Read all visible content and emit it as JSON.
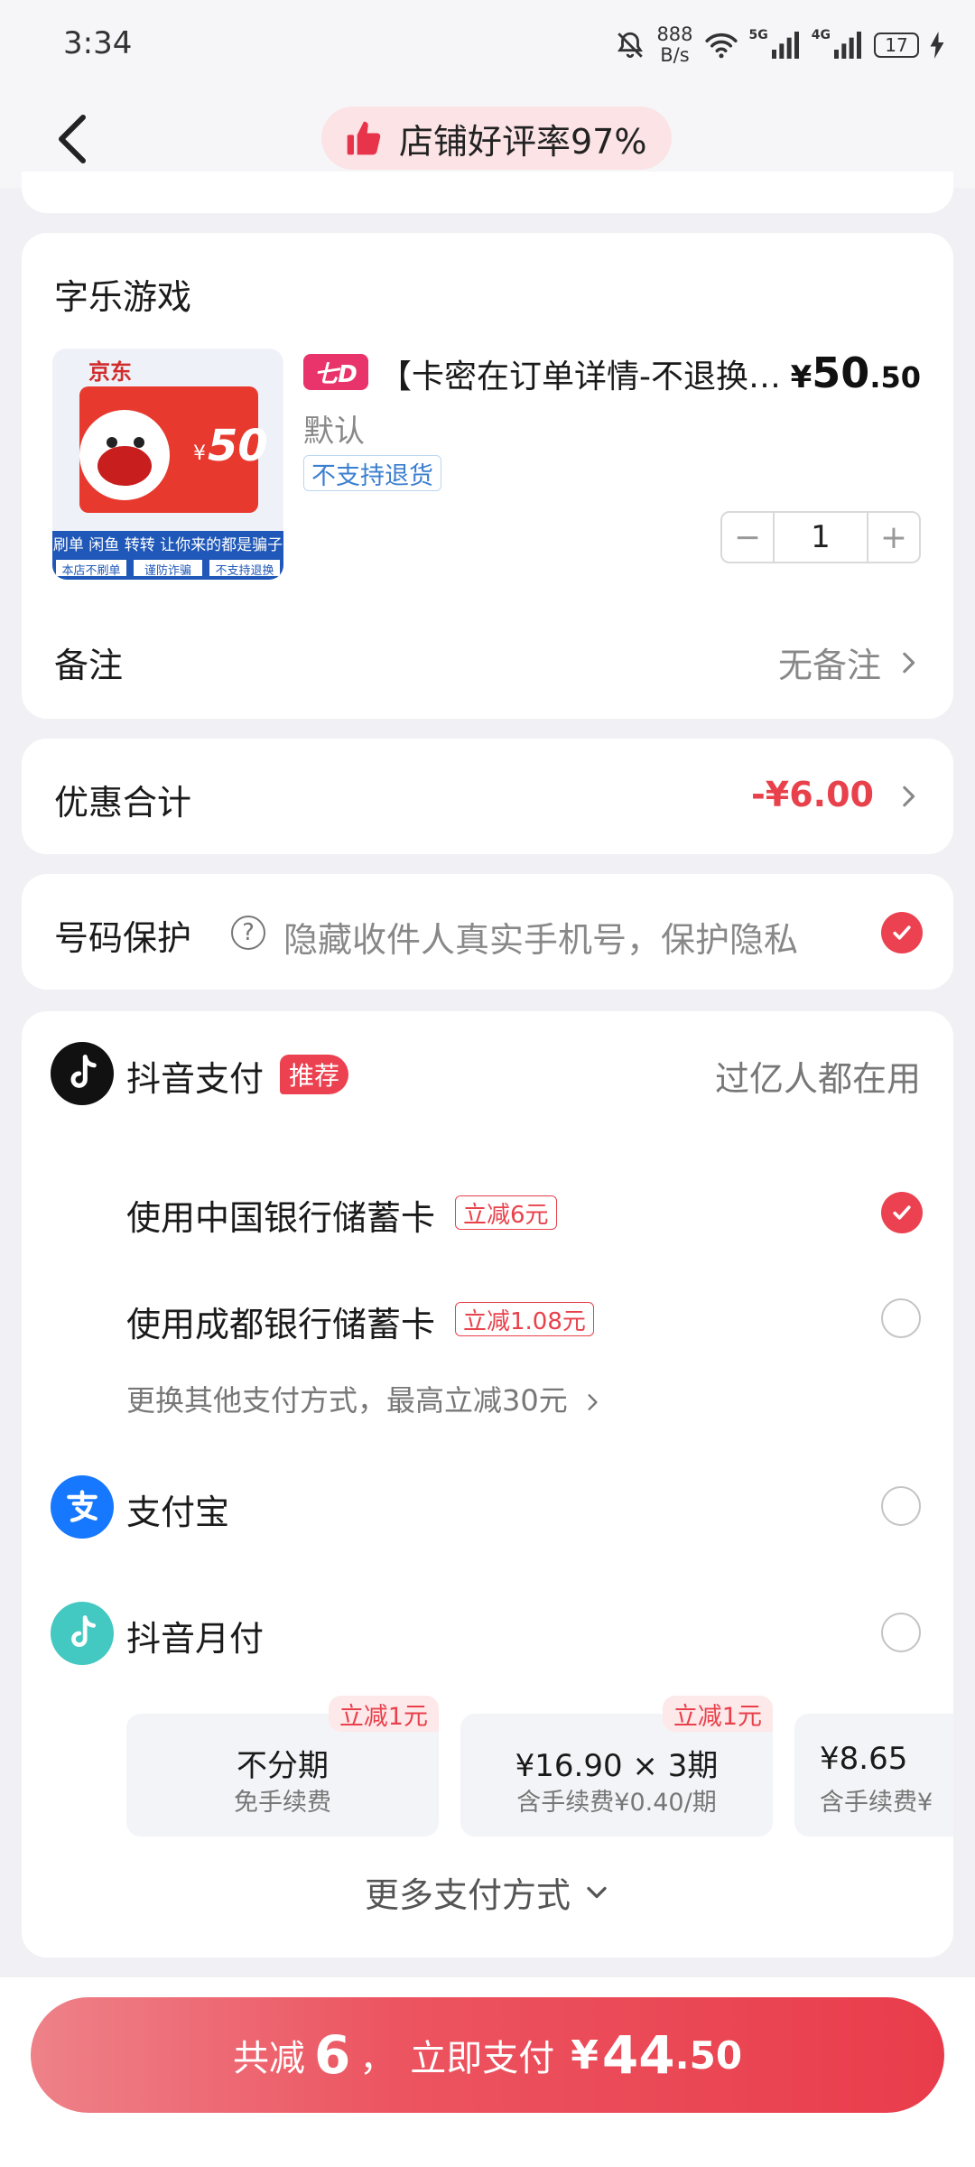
{
  "status_bar": {
    "time": "3:34",
    "net_speed_value": "888",
    "net_speed_unit": "B/s",
    "net_1": "5G",
    "net_2": "4G",
    "battery": "17"
  },
  "header": {
    "rating_text": "店铺好评率97%"
  },
  "shop": {
    "name": "字乐游戏",
    "thumb": {
      "brand": "京东",
      "card_value": "50",
      "currency": "¥",
      "banner_line1": "刷单 闲鱼 转转 让你来的都是骗子",
      "banner_tags": [
        "本店不刷单",
        "谨防诈骗",
        "不支持退换"
      ]
    },
    "seven_badge": "七D",
    "title": "【卡密在订单详情-不退换…",
    "price_symbol": "¥",
    "price_int": "50",
    "price_dec": ".50",
    "spec": "默认",
    "tag": "不支持退货",
    "quantity": "1",
    "minus": "−",
    "plus": "+",
    "remark_label": "备注",
    "remark_value": "无备注"
  },
  "discount": {
    "label": "优惠合计",
    "value": "-¥6.00"
  },
  "protection": {
    "label": "号码保护",
    "help": "?",
    "description": "隐藏收件人真实手机号，保护隐私",
    "checked": true
  },
  "payment": {
    "douyin_pay": {
      "label": "抖音支付",
      "badge": "推荐",
      "slogan": "过亿人都在用"
    },
    "cards": [
      {
        "label": "使用中国银行储蓄卡",
        "tag": "立减6元",
        "selected": true
      },
      {
        "label": "使用成都银行储蓄卡",
        "tag": "立减1.08元",
        "selected": false
      }
    ],
    "more_cards": "更换其他支付方式，最高立减30元",
    "alipay": {
      "label": "支付宝",
      "selected": false
    },
    "douyin_monthly": {
      "label": "抖音月付",
      "selected": false
    },
    "installments": [
      {
        "main": "不分期",
        "sub": "免手续费",
        "tag": "立减1元"
      },
      {
        "main": "¥16.90 × 3期",
        "sub": "含手续费¥0.40/期",
        "tag": "立减1元"
      },
      {
        "main": "¥8.65",
        "sub": "含手续费¥",
        "tag": ""
      }
    ],
    "more_methods": "更多支付方式"
  },
  "pay_button": {
    "prefix": "共减",
    "reduce_amount": "6",
    "comma": "，",
    "action": "立即支付",
    "currency": "¥",
    "amount_int": "44",
    "amount_dec": ".50"
  },
  "colors": {
    "accent_red": "#ec4150",
    "discount_red": "#e8414b",
    "tag_blue": "#3a7fd0",
    "alipay_blue": "#1677ff",
    "monthly_teal": "#44c8c2"
  }
}
